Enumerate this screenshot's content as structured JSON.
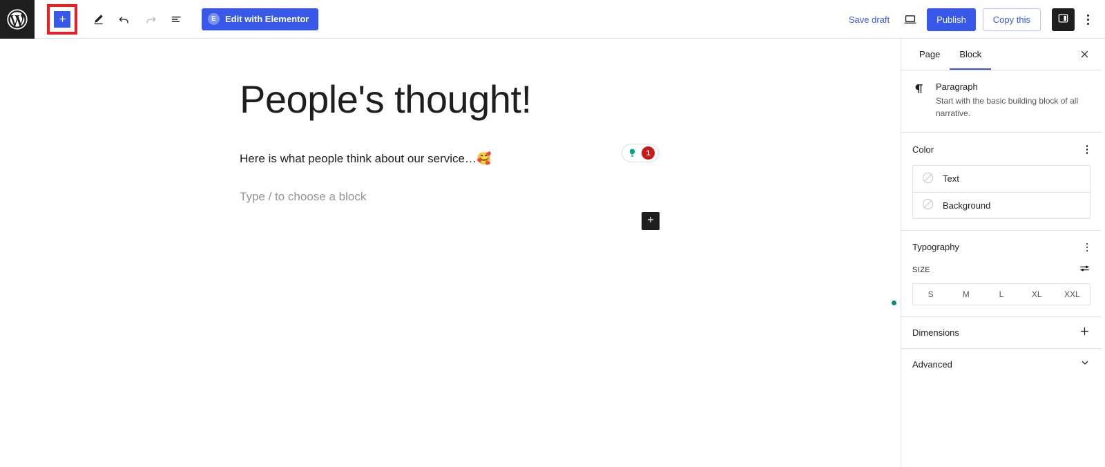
{
  "topbar": {
    "logo_icon": "wordpress-logo-icon",
    "inserter_label": "+",
    "inserter_icon": "plus-icon",
    "tools": [
      {
        "name": "edit-tool",
        "icon": "pencil-icon",
        "state": "enabled"
      },
      {
        "name": "undo",
        "icon": "undo-arrow-icon",
        "state": "enabled"
      },
      {
        "name": "redo",
        "icon": "redo-arrow-icon",
        "state": "disabled"
      },
      {
        "name": "list-view",
        "icon": "list-view-icon",
        "state": "enabled"
      }
    ],
    "elementor_button": {
      "label": "Edit with Elementor",
      "badge": "E",
      "icon": "elementor-logo-icon",
      "color": "#3858e9"
    },
    "save_draft_label": "Save draft",
    "preview_icon": "laptop-preview-icon",
    "publish_label": "Publish",
    "copy_label": "Copy this",
    "settings_toggle_icon": "sidebar-panel-icon",
    "options_icon": "kebab-menu-icon"
  },
  "annotation": {
    "arrow_icon": "red-up-arrow-icon",
    "highlight_color": "#ee1c23",
    "target": "block-inserter-button"
  },
  "editor": {
    "title": "People's thought!",
    "paragraph": "Here is what people think about our service…🥰",
    "placeholder": "Type / to choose a block",
    "appender_icon": "plus-icon",
    "seo_badge": {
      "icon": "lightbulb-icon",
      "icon_color": "#00a585",
      "count": "1",
      "count_color": "#cc1818"
    }
  },
  "sidebar": {
    "tabs": [
      {
        "label": "Page",
        "active": false
      },
      {
        "label": "Block",
        "active": true
      }
    ],
    "close_icon": "close-x-icon",
    "block_card": {
      "icon": "paragraph-pilcrow-icon",
      "title": "Paragraph",
      "description": "Start with the basic building block of all narrative."
    },
    "color_section": {
      "title": "Color",
      "menu_icon": "kebab-menu-icon",
      "options": [
        {
          "label": "Text",
          "swatch_icon": "no-color-circle-icon"
        },
        {
          "label": "Background",
          "swatch_icon": "no-color-circle-icon"
        }
      ]
    },
    "typography_section": {
      "title": "Typography",
      "menu_icon": "kebab-menu-icon",
      "size_label": "SIZE",
      "size_settings_icon": "sliders-icon",
      "sizes": [
        "S",
        "M",
        "L",
        "XL",
        "XXL"
      ],
      "selected_size": null
    },
    "dimensions_section": {
      "title": "Dimensions",
      "icon": "plus-icon"
    },
    "advanced_section": {
      "title": "Advanced",
      "icon": "chevron-down-icon"
    },
    "status_dot_color": "#0a8a7a"
  }
}
